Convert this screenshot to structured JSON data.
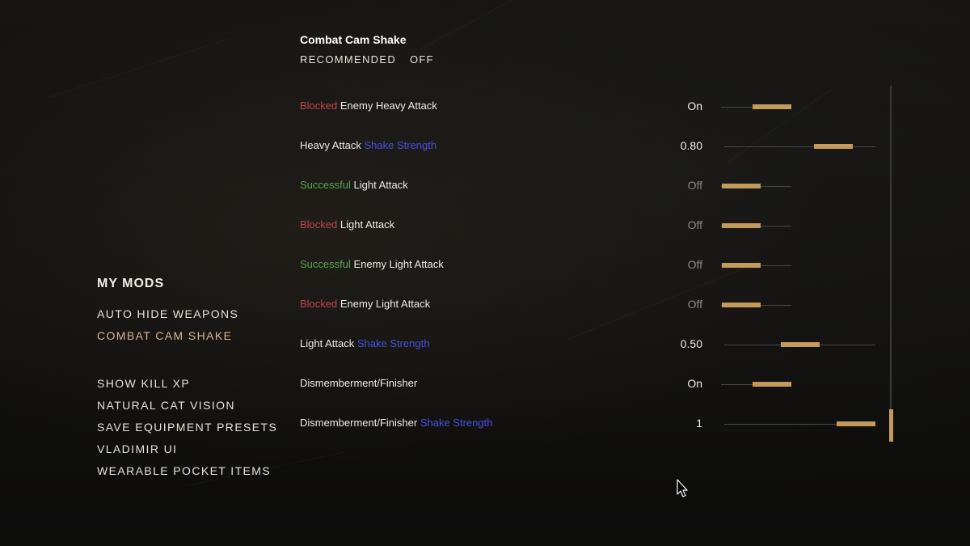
{
  "sidebar": {
    "heading": "MY MODS",
    "items_group1": [
      {
        "label": "AUTO HIDE WEAPONS",
        "selected": false
      },
      {
        "label": "COMBAT CAM SHAKE",
        "selected": true
      }
    ],
    "items_group2": [
      {
        "label": "SHOW KILL XP",
        "selected": false
      },
      {
        "label": "NATURAL CAT VISION",
        "selected": false
      },
      {
        "label": "SAVE EQUIPMENT PRESETS",
        "selected": false
      },
      {
        "label": "VLADIMIR UI",
        "selected": false
      },
      {
        "label": "WEARABLE POCKET ITEMS",
        "selected": false
      }
    ]
  },
  "panel": {
    "title": "Combat Cam Shake",
    "recommended_label": "RECOMMENDED",
    "recommended_value": "OFF"
  },
  "settings": [
    {
      "segments": [
        {
          "text": "Blocked",
          "color": "red"
        },
        {
          "text": " Enemy Heavy Attack",
          "color": "white"
        }
      ],
      "value": "On",
      "dim": false,
      "slider": {
        "type": "toggle",
        "level": 1
      }
    },
    {
      "segments": [
        {
          "text": "Heavy Attack ",
          "color": "white"
        },
        {
          "text": "Shake Strength",
          "color": "blue"
        }
      ],
      "value": "0.80",
      "dim": false,
      "slider": {
        "type": "range",
        "level": 0.8
      }
    },
    {
      "segments": [
        {
          "text": "Successful",
          "color": "green"
        },
        {
          "text": " Light Attack",
          "color": "white"
        }
      ],
      "value": "Off",
      "dim": true,
      "slider": {
        "type": "toggle",
        "level": 0
      }
    },
    {
      "segments": [
        {
          "text": "Blocked",
          "color": "red"
        },
        {
          "text": " Light Attack",
          "color": "white"
        }
      ],
      "value": "Off",
      "dim": true,
      "slider": {
        "type": "toggle",
        "level": 0
      }
    },
    {
      "segments": [
        {
          "text": "Successful",
          "color": "green"
        },
        {
          "text": " Enemy Light Attack",
          "color": "white"
        }
      ],
      "value": "Off",
      "dim": true,
      "slider": {
        "type": "toggle",
        "level": 0
      }
    },
    {
      "segments": [
        {
          "text": "Blocked",
          "color": "red"
        },
        {
          "text": " Enemy Light Attack",
          "color": "white"
        }
      ],
      "value": "Off",
      "dim": true,
      "slider": {
        "type": "toggle",
        "level": 0
      }
    },
    {
      "segments": [
        {
          "text": "Light Attack ",
          "color": "white"
        },
        {
          "text": "Shake Strength",
          "color": "blue"
        }
      ],
      "value": "0.50",
      "dim": false,
      "slider": {
        "type": "range",
        "level": 0.5
      }
    },
    {
      "segments": [
        {
          "text": "Dismemberment/Finisher",
          "color": "white"
        }
      ],
      "value": "On",
      "dim": false,
      "slider": {
        "type": "toggle",
        "level": 1
      }
    },
    {
      "segments": [
        {
          "text": "Dismemberment/Finisher ",
          "color": "white"
        },
        {
          "text": "Shake Strength",
          "color": "blue"
        }
      ],
      "value": "1",
      "dim": false,
      "slider": {
        "type": "range",
        "level": 1
      }
    }
  ],
  "scrollbar": {
    "position": 1
  },
  "colors": {
    "accent_gold": "#c49a5c",
    "selected_mod": "#d8b592",
    "red": "#c0454a",
    "green": "#58a34f",
    "blue": "#4650e0"
  },
  "icons": {
    "cursor": "mouse-pointer-icon"
  }
}
